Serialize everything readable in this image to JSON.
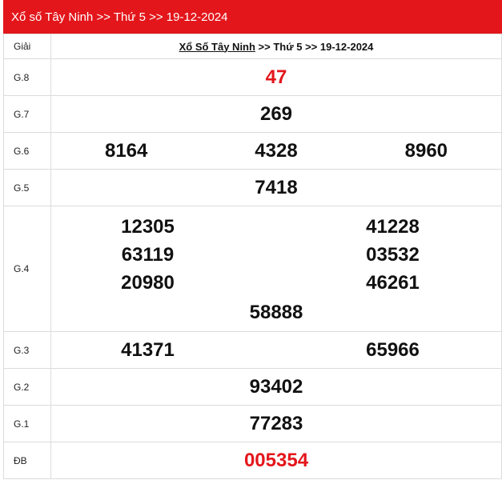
{
  "banner": {
    "title": "Xổ số Tây Ninh >> Thứ 5 >> 19-12-2024"
  },
  "header": {
    "label": "Giải",
    "link": "Xổ Số Tây Ninh",
    "rest": " >> Thứ 5 >> 19-12-2024"
  },
  "prizes": {
    "g8": {
      "label": "G.8",
      "numbers": [
        "47"
      ]
    },
    "g7": {
      "label": "G.7",
      "numbers": [
        "269"
      ]
    },
    "g6": {
      "label": "G.6",
      "numbers": [
        "8164",
        "4328",
        "8960"
      ]
    },
    "g5": {
      "label": "G.5",
      "numbers": [
        "7418"
      ]
    },
    "g4": {
      "label": "G.4",
      "numbers": [
        "12305",
        "41228",
        "63119",
        "03532",
        "20980",
        "46261",
        "58888"
      ]
    },
    "g3": {
      "label": "G.3",
      "numbers": [
        "41371",
        "65966"
      ]
    },
    "g2": {
      "label": "G.2",
      "numbers": [
        "93402"
      ]
    },
    "g1": {
      "label": "G.1",
      "numbers": [
        "77283"
      ]
    },
    "db": {
      "label": "ĐB",
      "numbers": [
        "005354"
      ]
    }
  },
  "colors": {
    "accent": "#e3161b",
    "text": "#111111",
    "border": "#dcdcdc"
  }
}
